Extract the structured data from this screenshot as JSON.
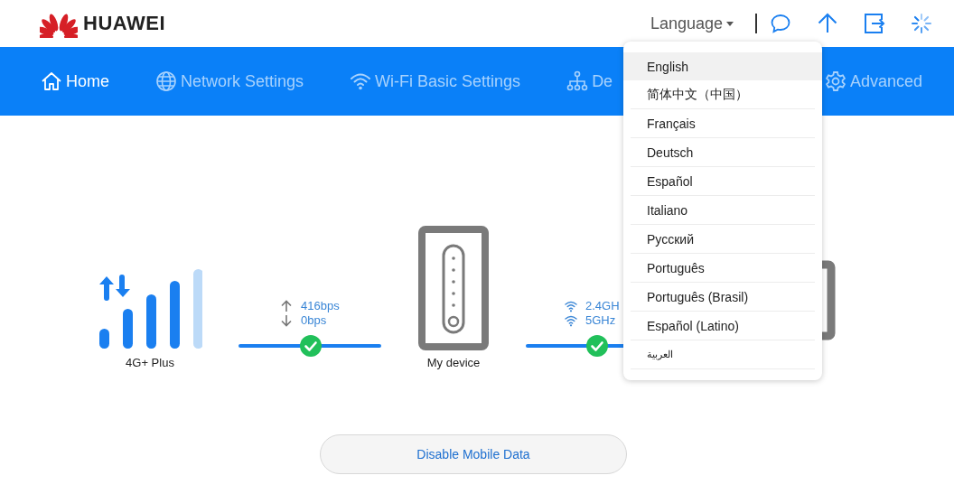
{
  "header": {
    "brand": "HUAWEI",
    "language_label": "Language"
  },
  "nav": [
    {
      "label": "Home",
      "selected": true
    },
    {
      "label": "Network Settings",
      "selected": false
    },
    {
      "label": "Wi-Fi Basic Settings",
      "selected": false
    },
    {
      "label": "De",
      "selected": false
    },
    {
      "label": "Advanced",
      "selected": false
    }
  ],
  "status": {
    "network": {
      "label": "4G+ Plus"
    },
    "links": [
      {
        "rows": [
          "416bps",
          "0bps"
        ]
      },
      {
        "rows": [
          "2.4GH",
          "5GHz"
        ]
      }
    ],
    "device": {
      "label": "My device"
    }
  },
  "button": "Disable Mobile Data",
  "language_menu": [
    {
      "label": "English",
      "selected": true
    },
    {
      "label": "简体中文（中国）",
      "selected": false
    },
    {
      "label": "Français",
      "selected": false
    },
    {
      "label": "Deutsch",
      "selected": false
    },
    {
      "label": "Español",
      "selected": false
    },
    {
      "label": "Italiano",
      "selected": false
    },
    {
      "label": "Русский",
      "selected": false
    },
    {
      "label": "Português",
      "selected": false
    },
    {
      "label": "Português (Brasil)",
      "selected": false
    },
    {
      "label": "Español (Latino)",
      "selected": false
    },
    {
      "label": "العربية",
      "selected": false
    }
  ]
}
